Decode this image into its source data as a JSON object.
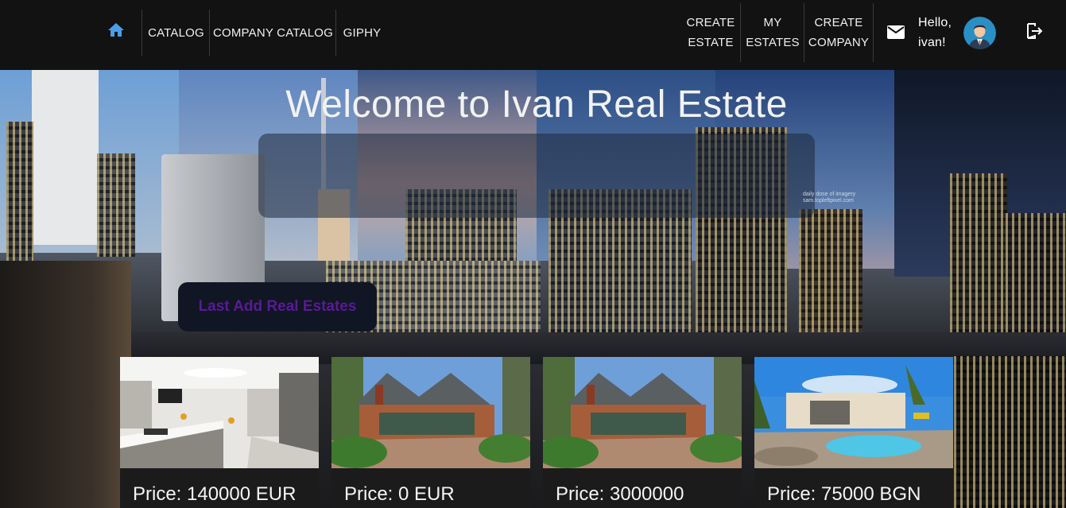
{
  "nav": {
    "home_icon": "home-icon",
    "links": [
      {
        "label": "CATALOG"
      },
      {
        "label": "COMPANY CATALOG"
      },
      {
        "label": "GIPHY"
      }
    ],
    "right_links": [
      {
        "line1": "CREATE",
        "line2": "ESTATE"
      },
      {
        "line1": "MY",
        "line2": "ESTATES"
      },
      {
        "line1": "CREATE",
        "line2": "COMPANY"
      }
    ],
    "mail_icon": "mail-icon",
    "greeting_line1": "Hello,",
    "greeting_line2": "ivan!",
    "avatar_icon": "user-avatar",
    "logout_icon": "logout-icon"
  },
  "hero": {
    "title": "Welcome to Ivan Real Estate",
    "last_button": "Last Add Real Estates"
  },
  "cards": [
    {
      "price": "Price: 140000 EUR",
      "image": "kitchen-interior"
    },
    {
      "price": "Price: 0 EUR",
      "image": "house-exterior"
    },
    {
      "price": "Price: 3000000",
      "image": "house-exterior"
    },
    {
      "price": "Price: 75000 BGN",
      "image": "villa-pool"
    }
  ],
  "colors": {
    "navbar": "#121212",
    "home_icon": "#4a9ee8",
    "button_text": "#5a1a96"
  }
}
